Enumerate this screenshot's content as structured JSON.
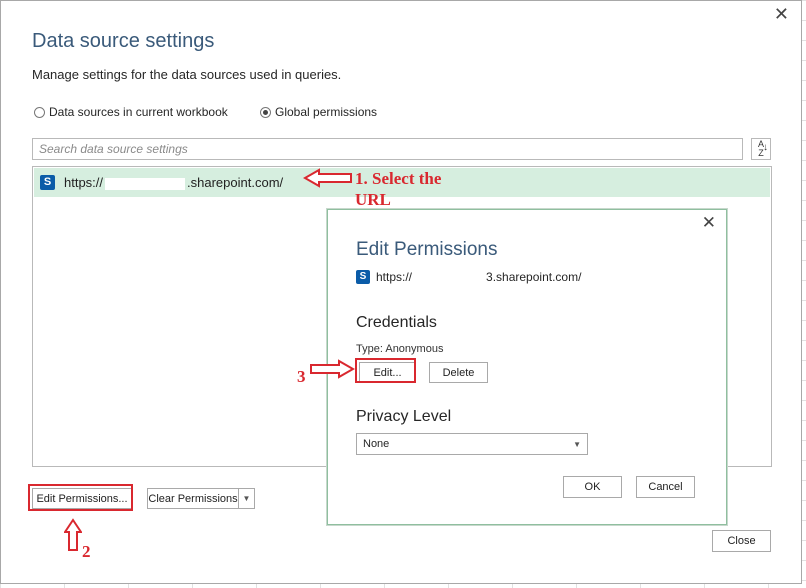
{
  "dialog": {
    "title": "Data source settings",
    "subtitle": "Manage settings for the data sources used in queries.",
    "radio_workbook": "Data sources in current workbook",
    "radio_global": "Global permissions",
    "search_placeholder": "Search data source settings",
    "list_item_prefix": "https://",
    "list_item_suffix": ".sharepoint.com/",
    "edit_permissions_label": "Edit Permissions...",
    "clear_permissions_label": "Clear Permissions",
    "close_label": "Close"
  },
  "edit_permissions": {
    "title": "Edit Permissions",
    "url_prefix": "https://",
    "url_suffix": "3.sharepoint.com/",
    "credentials_heading": "Credentials",
    "type_text": "Type: Anonymous",
    "edit_label": "Edit...",
    "delete_label": "Delete",
    "privacy_heading": "Privacy Level",
    "privacy_value": "None",
    "ok_label": "OK",
    "cancel_label": "Cancel"
  },
  "annotations": {
    "step1_line1": "1. Select the",
    "step1_line2": "URL",
    "step2": "2",
    "step3": "3"
  },
  "icons": {
    "sharepoint": "S",
    "close": "✕",
    "sort": "A↓Z"
  },
  "colors": {
    "selected_row": "#d6eedf",
    "title": "#3a5a7a",
    "annotation_red": "#d9282f"
  }
}
